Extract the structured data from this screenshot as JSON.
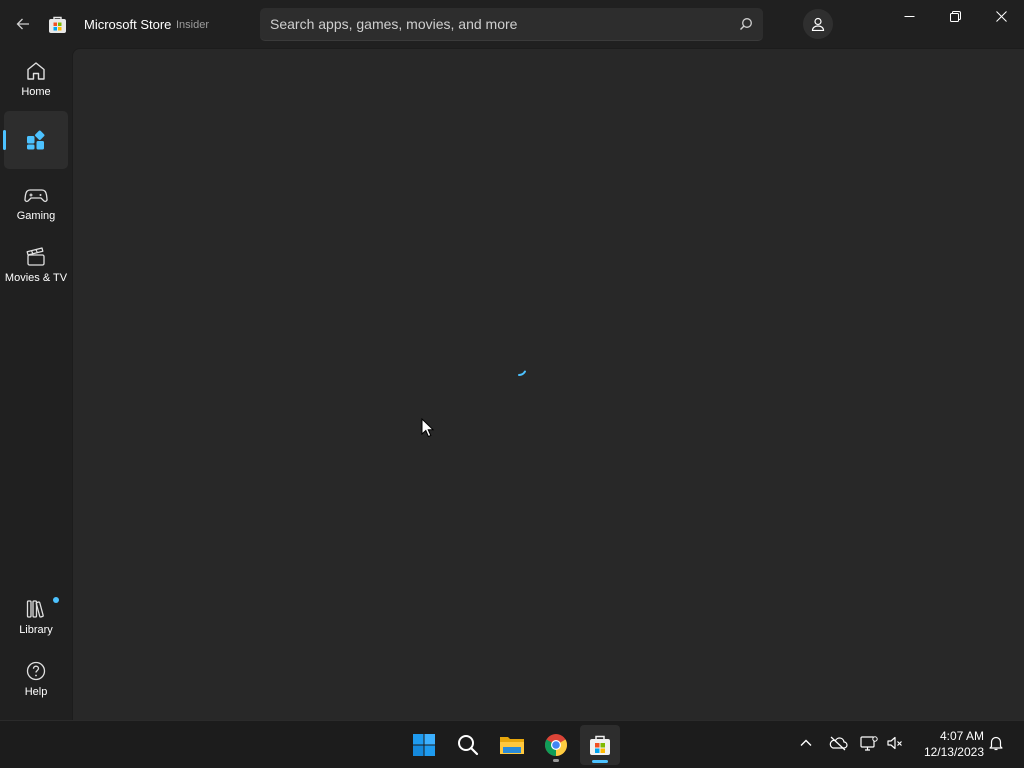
{
  "app": {
    "title": "Microsoft Store",
    "badge": "Insider"
  },
  "search": {
    "placeholder": "Search apps, games, movies, and more"
  },
  "nav": {
    "items": [
      {
        "label": "Home",
        "icon": "home-icon"
      },
      {
        "label": "",
        "icon": "apps-icon",
        "selected": true
      },
      {
        "label": "Gaming",
        "icon": "gamepad-icon"
      },
      {
        "label": "Movies & TV",
        "icon": "clapperboard-icon"
      },
      {
        "label": "Library",
        "icon": "library-icon",
        "has_notification": true
      },
      {
        "label": "Help",
        "icon": "help-icon"
      }
    ]
  },
  "content": {
    "state": "loading"
  },
  "taskbar": {
    "apps": [
      "start",
      "search",
      "file-explorer",
      "chrome",
      "microsoft-store"
    ],
    "active_app": "microsoft-store",
    "clock": {
      "time": "4:07 AM",
      "date": "12/13/2023"
    }
  },
  "colors": {
    "accent": "#4cc2ff",
    "background": "#202020",
    "content": "#282828"
  }
}
